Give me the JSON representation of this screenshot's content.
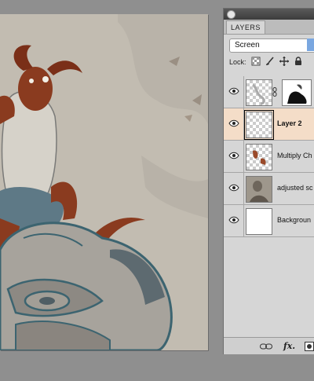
{
  "panel": {
    "tab_label": "LAYERS",
    "blend_mode": "Screen",
    "lock_label": "Lock:"
  },
  "layers": [
    {
      "name": "",
      "has_mask": true,
      "visible": true,
      "active": false
    },
    {
      "name": "Layer 2",
      "has_mask": false,
      "visible": true,
      "active": true
    },
    {
      "name": "Multiply Ch",
      "has_mask": false,
      "visible": true,
      "active": false
    },
    {
      "name": "adjusted sc",
      "has_mask": false,
      "visible": true,
      "active": false
    },
    {
      "name": "Backgroun",
      "has_mask": false,
      "visible": true,
      "active": false
    }
  ],
  "bottom_bar": {
    "fx_label": "fx."
  },
  "colors": {
    "active_layer": "#f4ddc8",
    "canvas_paper": "#c2bcb1",
    "workspace": "#8f8f8f",
    "character_skin": "#8a3b1f",
    "stone_teal": "#3c6470"
  },
  "icons": [
    "eye-icon",
    "link-icon",
    "lock-transparent-icon",
    "brush-icon",
    "move-icon",
    "padlock-icon",
    "chain-icon",
    "fx-icon",
    "new-layer-icon"
  ]
}
